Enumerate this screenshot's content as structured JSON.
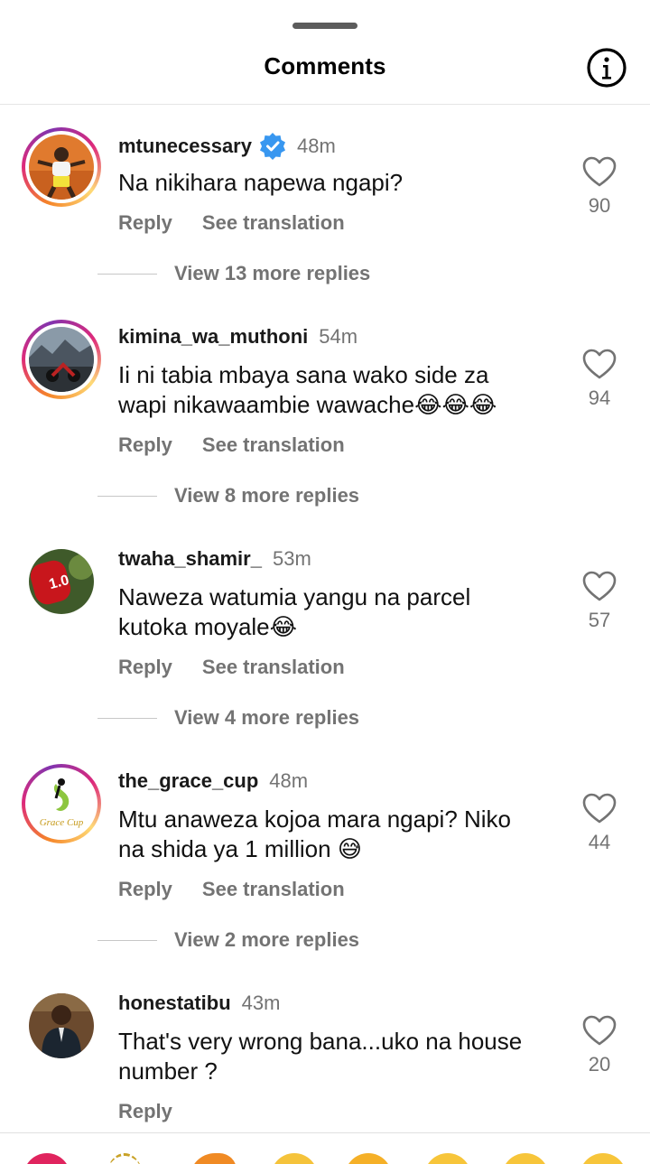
{
  "header": {
    "title": "Comments",
    "info_icon": "info-icon"
  },
  "comments": [
    {
      "username": "mtunecessary",
      "verified": true,
      "time": "48m",
      "text": "Na nikihara napewa ngapi?",
      "emojis": "",
      "reply_label": "Reply",
      "translate_label": "See translation",
      "likes": "90",
      "replies_label": "View 13 more replies"
    },
    {
      "username": "kimina_wa_muthoni",
      "verified": false,
      "time": "54m",
      "text_line1": "Ii ni tabia mbaya sana wako side za",
      "text_line2": "wapi nikawaambie wawache",
      "emojis": "😂😂😂",
      "reply_label": "Reply",
      "translate_label": "See translation",
      "likes": "94",
      "replies_label": "View 8 more replies"
    },
    {
      "username": "twaha_shamir_",
      "verified": false,
      "time": "53m",
      "text_line1": "Naweza watumia yangu na parcel",
      "text_line2": "kutoka moyale",
      "emojis": "😂",
      "reply_label": "Reply",
      "translate_label": "See translation",
      "likes": "57",
      "replies_label": "View 4 more replies"
    },
    {
      "username": "the_grace_cup",
      "verified": false,
      "time": "48m",
      "text_line1": "Mtu anaweza kojoa mara ngapi? Niko",
      "text_line2": "na shida ya 1 million ",
      "emojis": "😅",
      "reply_label": "Reply",
      "translate_label": "See translation",
      "likes": "44",
      "replies_label": "View 2 more replies",
      "avatar_logo_text": "Grace Cup"
    },
    {
      "username": "honestatibu",
      "verified": false,
      "time": "43m",
      "text_line1": "That's very wrong bana...uko na house",
      "text_line2": "number ?",
      "emojis": "",
      "reply_label": "Reply",
      "likes": "20"
    }
  ],
  "reactions": [
    "❤️",
    "🙌",
    "🔥",
    "👏",
    "😢",
    "😍",
    "😮",
    "😂"
  ],
  "colors": {
    "link_gray": "#737373",
    "verified_blue": "#3897f0",
    "text": "#111111"
  }
}
